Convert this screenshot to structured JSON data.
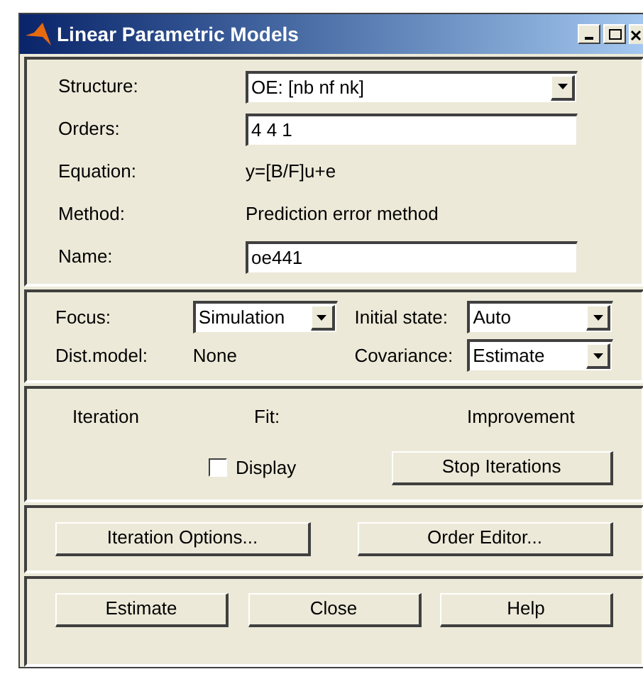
{
  "window": {
    "title": "Linear Parametric Models"
  },
  "model": {
    "fields": [
      {
        "kind": "dropdown",
        "label": "Structure:",
        "value": "OE: [nb nf nk]"
      },
      {
        "kind": "input",
        "label": "Orders:",
        "value": "4 4 1"
      },
      {
        "kind": "text",
        "label": "Equation:",
        "value": "y=[B/F]u+e"
      },
      {
        "kind": "text",
        "label": "Method:",
        "value": "Prediction error method"
      },
      {
        "kind": "input",
        "label": "Name:",
        "value": "oe441"
      }
    ]
  },
  "options": {
    "focus": {
      "label": "Focus:",
      "value": "Simulation"
    },
    "initial_state": {
      "label": "Initial state:",
      "value": "Auto"
    },
    "dist_model": {
      "label": "Dist.model:",
      "value": "None"
    },
    "covariance": {
      "label": "Covariance:",
      "value": "Estimate"
    }
  },
  "iteration": {
    "columns": [
      "Iteration",
      "Fit:",
      "Improvement"
    ],
    "display": {
      "label": "Display",
      "checked": false
    },
    "stop_button": "Stop Iterations"
  },
  "tool_buttons": [
    "Iteration Options...",
    "Order Editor..."
  ],
  "buttons": [
    "Estimate",
    "Close",
    "Help"
  ]
}
